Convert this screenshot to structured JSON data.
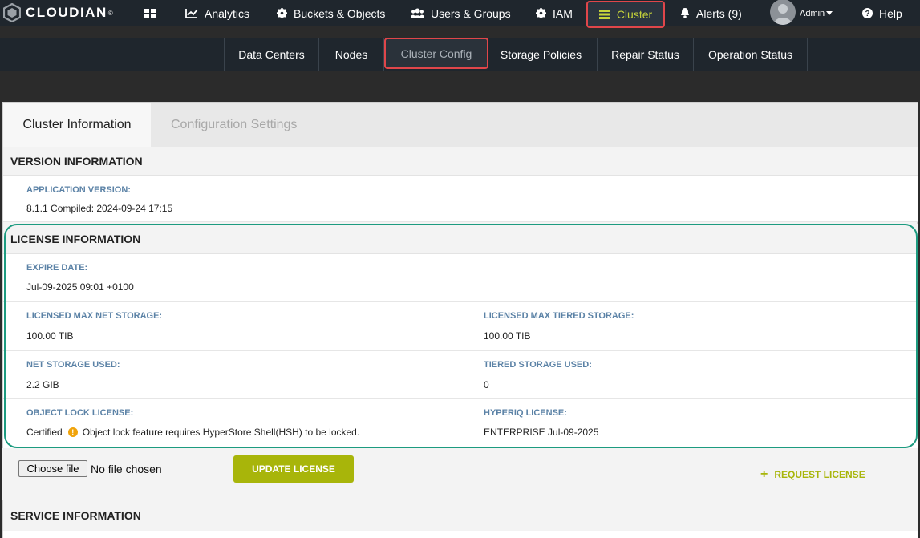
{
  "brand": {
    "name": "CLOUDIAN",
    "reg": "®"
  },
  "topnav": {
    "analytics": "Analytics",
    "buckets": "Buckets & Objects",
    "users": "Users & Groups",
    "iam": "IAM",
    "cluster": "Cluster",
    "alerts": "Alerts (9)",
    "user": "Admin",
    "help": "Help"
  },
  "subnav": {
    "data_centers": "Data Centers",
    "nodes": "Nodes",
    "cluster_config": "Cluster Config",
    "storage_policies": "Storage Policies",
    "repair_status": "Repair Status",
    "operation_status": "Operation Status"
  },
  "tabs": {
    "cluster_information": "Cluster Information",
    "configuration_settings": "Configuration Settings"
  },
  "version": {
    "header": "VERSION INFORMATION",
    "app_version_label": "APPLICATION VERSION:",
    "app_version_value": "8.1.1 Compiled: 2024-09-24 17:15"
  },
  "license": {
    "header": "LICENSE INFORMATION",
    "expire_label": "EXPIRE DATE:",
    "expire_value": "Jul-09-2025 09:01 +0100",
    "max_net_label": "LICENSED MAX NET STORAGE:",
    "max_net_value": "100.00 TIB",
    "max_tiered_label": "LICENSED MAX TIERED STORAGE:",
    "max_tiered_value": "100.00 TIB",
    "net_used_label": "NET STORAGE USED:",
    "net_used_value": "2.2 GIB",
    "tiered_used_label": "TIERED STORAGE USED:",
    "tiered_used_value": "0",
    "object_lock_label": "OBJECT LOCK LICENSE:",
    "object_lock_status": "Certified",
    "object_lock_warning": "Object lock feature requires HyperStore Shell(HSH) to be locked.",
    "hyperiq_label": "HYPERIQ LICENSE:",
    "hyperiq_value": "ENTERPRISE Jul-09-2025"
  },
  "upload": {
    "choose_file": "Choose file",
    "no_file": "No file chosen",
    "update_license": "UPDATE LICENSE",
    "request_license": "REQUEST LICENSE"
  },
  "service": {
    "header": "SERVICE INFORMATION"
  },
  "colors": {
    "accent": "#a8b50a",
    "highlight": "#e0464a",
    "outline": "#1c9b80",
    "label": "#5b82a6"
  }
}
